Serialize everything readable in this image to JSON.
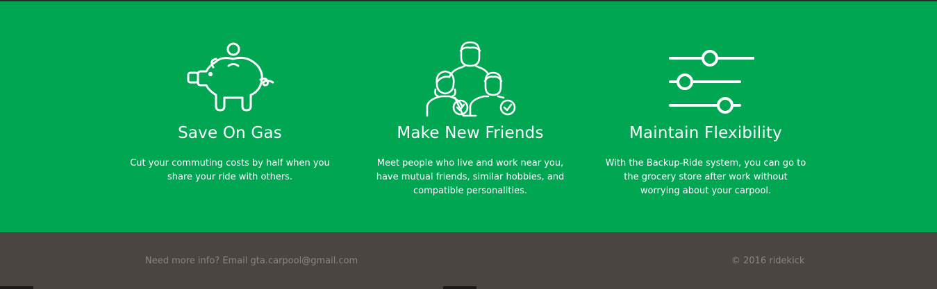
{
  "features": [
    {
      "icon": "piggy-bank-icon",
      "title": "Save On Gas",
      "description": "Cut your commuting costs by half when you share your ride with others."
    },
    {
      "icon": "people-group-icon",
      "title": "Make New Friends",
      "description": "Meet people who live and work near you, have mutual friends, similar hobbies, and compatible personalities."
    },
    {
      "icon": "sliders-icon",
      "title": "Maintain Flexibility",
      "description": "With the Backup-Ride system, you can go to the grocery store after work without worrying about your carpool."
    }
  ],
  "footer": {
    "info": "Need more info? Email gta.carpool@gmail.com",
    "copyright": "© 2016 ridekick"
  },
  "colors": {
    "accent": "#00a651",
    "footer_bg": "#4b4542",
    "footer_text": "#8a8583"
  }
}
